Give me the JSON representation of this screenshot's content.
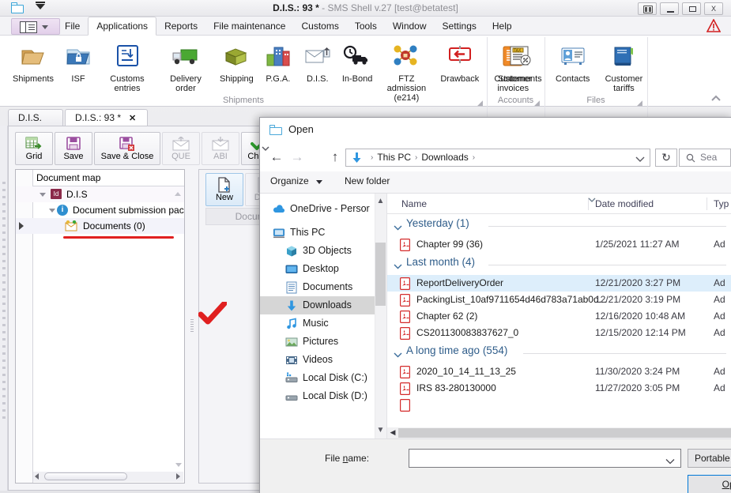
{
  "window": {
    "title_bold": "D.I.S.: 93 *",
    "title_rest": " - SMS Shell v.27 [test@betatest]",
    "buttons": {
      "restore": "restore-down",
      "minimize": "minimize",
      "maximize": "maximize",
      "close": "close"
    }
  },
  "menu": {
    "items": [
      {
        "label": "File",
        "active": false
      },
      {
        "label": "Applications",
        "active": true
      },
      {
        "label": "Reports",
        "active": false
      },
      {
        "label": "File maintenance",
        "active": false
      },
      {
        "label": "Customs",
        "active": false
      },
      {
        "label": "Tools",
        "active": false
      },
      {
        "label": "Window",
        "active": false
      },
      {
        "label": "Settings",
        "active": false
      },
      {
        "label": "Help",
        "active": false
      }
    ]
  },
  "ribbon": {
    "groups": [
      {
        "name": "Shipments",
        "buttons": [
          {
            "label": "Shipments"
          },
          {
            "label": "ISF"
          },
          {
            "label": "Customs entries"
          },
          {
            "label": "Delivery order"
          },
          {
            "label": "Shipping"
          },
          {
            "label": "P.G.A."
          },
          {
            "label": "D.I.S."
          },
          {
            "label": "In-Bond"
          },
          {
            "label": "FTZ admission (e214)"
          },
          {
            "label": "Drawback"
          },
          {
            "label": "Customer invoices"
          }
        ]
      },
      {
        "name": "Accounts",
        "buttons": [
          {
            "label": "Statements"
          }
        ]
      },
      {
        "name": "Files",
        "buttons": [
          {
            "label": "Contacts"
          },
          {
            "label": "Customer tariffs"
          }
        ]
      }
    ]
  },
  "doc_tabs": [
    {
      "label": "D.I.S.",
      "selected": false,
      "closable": false
    },
    {
      "label": "D.I.S.: 93 *",
      "selected": true,
      "closable": true,
      "close_glyph": "✕"
    }
  ],
  "toolbar": {
    "buttons": [
      {
        "label": "Grid",
        "enabled": true
      },
      {
        "label": "Save",
        "enabled": true
      },
      {
        "label": "Save & Close",
        "enabled": true
      },
      {
        "label": "QUE",
        "enabled": false
      },
      {
        "label": "ABI",
        "enabled": false
      },
      {
        "label": "Check",
        "enabled": true
      }
    ]
  },
  "document_map": {
    "header": "Document map",
    "rows": [
      {
        "label": "D.I.S",
        "depth": 0
      },
      {
        "label": "Document submission pac",
        "depth": 1
      },
      {
        "label": "Documents (0)",
        "depth": 2,
        "selected": true,
        "underlined": true
      }
    ]
  },
  "right_pane": {
    "new_label": "New",
    "delete_label": "Dele",
    "group_label": "Document"
  },
  "dialog": {
    "title": "Open",
    "nav": {
      "back": "←",
      "forward": "→",
      "recent": "⌄",
      "up": "↑",
      "refresh": "↻"
    },
    "breadcrumb": [
      "This PC",
      "Downloads"
    ],
    "breadcrumb_sep": "›",
    "search_placeholder": "Sea",
    "commands": {
      "organize": "Organize",
      "new_folder": "New folder"
    },
    "nav_pane": [
      {
        "label": "OneDrive - Persor",
        "icon": "onedrive-icon",
        "indent": 16,
        "selected": false
      },
      {
        "label": "This PC",
        "icon": "pc-icon",
        "indent": 16,
        "selected": false
      },
      {
        "label": "3D Objects",
        "icon": "3dobjects-icon",
        "indent": 32,
        "selected": false
      },
      {
        "label": "Desktop",
        "icon": "desktop-icon",
        "indent": 32,
        "selected": false
      },
      {
        "label": "Documents",
        "icon": "documents-icon",
        "indent": 32,
        "selected": false
      },
      {
        "label": "Downloads",
        "icon": "downloads-icon",
        "indent": 32,
        "selected": true
      },
      {
        "label": "Music",
        "icon": "music-icon",
        "indent": 32,
        "selected": false
      },
      {
        "label": "Pictures",
        "icon": "pictures-icon",
        "indent": 32,
        "selected": false
      },
      {
        "label": "Videos",
        "icon": "videos-icon",
        "indent": 32,
        "selected": false
      },
      {
        "label": "Local Disk (C:)",
        "icon": "drive-icon",
        "indent": 32,
        "selected": false
      },
      {
        "label": "Local Disk (D:)",
        "icon": "drive-icon",
        "indent": 32,
        "selected": false
      }
    ],
    "columns": [
      "Name",
      "Date modified",
      "Typ"
    ],
    "groups": [
      {
        "title": "Yesterday (1)",
        "files": [
          {
            "name": "Chapter 99 (36)",
            "date": "1/25/2021 11:27 AM",
            "type": "Ad",
            "selected": false
          }
        ]
      },
      {
        "title": "Last month (4)",
        "files": [
          {
            "name": "ReportDeliveryOrder",
            "date": "12/21/2020 3:27 PM",
            "type": "Ad",
            "selected": true
          },
          {
            "name": "PackingList_10af9711654d46d783a71ab0d...",
            "date": "12/21/2020 3:19 PM",
            "type": "Ad",
            "selected": false
          },
          {
            "name": "Chapter 62 (2)",
            "date": "12/16/2020 10:48 AM",
            "type": "Ad",
            "selected": false
          },
          {
            "name": "CS201130083837627_0",
            "date": "12/15/2020 12:14 PM",
            "type": "Ad",
            "selected": false
          }
        ]
      },
      {
        "title": "A long time ago (554)",
        "files": [
          {
            "name": "2020_10_14_11_13_25",
            "date": "11/30/2020 3:24 PM",
            "type": "Ad",
            "selected": false
          },
          {
            "name": "IRS 83-280130000",
            "date": "11/27/2020 3:05 PM",
            "type": "Ad",
            "selected": false
          }
        ]
      }
    ],
    "footer": {
      "filename_label_pre": "File ",
      "filename_label_key": "n",
      "filename_label_post": "ame:",
      "filename_value": "",
      "filter_label": "Portable",
      "open_key": "O",
      "open_post": "pe"
    }
  },
  "colors": {
    "accent_blue": "#0078d7",
    "selection_row": "#ddeefb",
    "group_header_text": "#2f5d8a",
    "annotation_red": "#e02020"
  }
}
